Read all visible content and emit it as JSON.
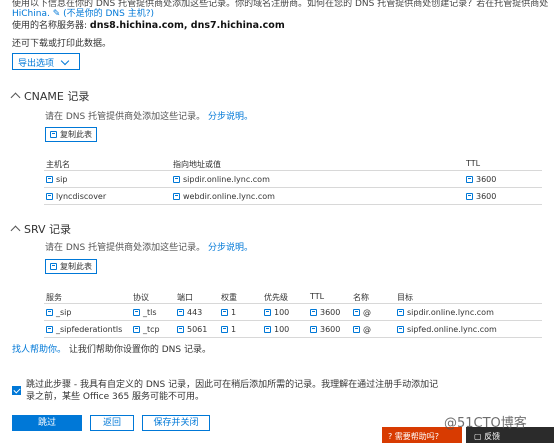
{
  "header": {
    "intro_cut": "使用以下信息在你的 DNS 托管提供商处添加这些记录。你的域名注册商。如何在您的 DNS 托管提供商处创建记录？若在托管提供商处",
    "hichina_link": "HiChina. ✎ (不是你的 DNS 主机?)",
    "ns_label": "使用的名称服务器: ",
    "ns_value": "dns8.hichina.com, dns7.hichina.com",
    "download_text": "还可下载或打印此数据。",
    "export_label": "导出选项"
  },
  "cname": {
    "title": "CNAME 记录",
    "hint": "请在 DNS 托管提供商处添加这些记录。",
    "hint_link": "分步说明。",
    "copy_label": "复制此表",
    "headers": [
      "主机名",
      "指向地址或值",
      "TTL"
    ],
    "rows": [
      {
        "host": "sip",
        "value": "sipdir.online.lync.com",
        "ttl": "3600"
      },
      {
        "host": "lyncdiscover",
        "value": "webdir.online.lync.com",
        "ttl": "3600"
      }
    ]
  },
  "srv": {
    "title": "SRV 记录",
    "hint": "请在 DNS 托管提供商处添加这些记录。",
    "hint_link": "分步说明。",
    "copy_label": "复制此表",
    "headers": [
      "服务",
      "协议",
      "端口",
      "权重",
      "优先级",
      "TTL",
      "名称",
      "目标"
    ],
    "rows": [
      {
        "service": "_sip",
        "protocol": "_tls",
        "port": "443",
        "weight": "1",
        "priority": "100",
        "ttl": "3600",
        "name": "@",
        "target": "sipdir.online.lync.com"
      },
      {
        "service": "_sipfederationtls",
        "protocol": "_tcp",
        "port": "5061",
        "weight": "1",
        "priority": "100",
        "ttl": "3600",
        "name": "@",
        "target": "sipfed.online.lync.com"
      }
    ]
  },
  "help": {
    "link": "找人帮助你。",
    "text": " 让我们帮助你设置你的 DNS 记录。"
  },
  "skip": {
    "text1": "跳过此步骤 - 我具有自定义的 DNS 记录，因此可在稍后添加所需的记录。我理解在通过注册手动添加记",
    "text2": "录之前，某些 Office 365 服务可能不可用。"
  },
  "buttons": {
    "skip": "跳过",
    "back": "返回",
    "save_close": "保存并关闭"
  },
  "floating": {
    "need_help": "需要帮助吗?",
    "feedback": "反馈"
  },
  "watermark": "@51CTO博客",
  "colors": {
    "accent": "#0078d7",
    "help_tab": "#d83b01",
    "feedback_tab": "#2b2b2b"
  }
}
